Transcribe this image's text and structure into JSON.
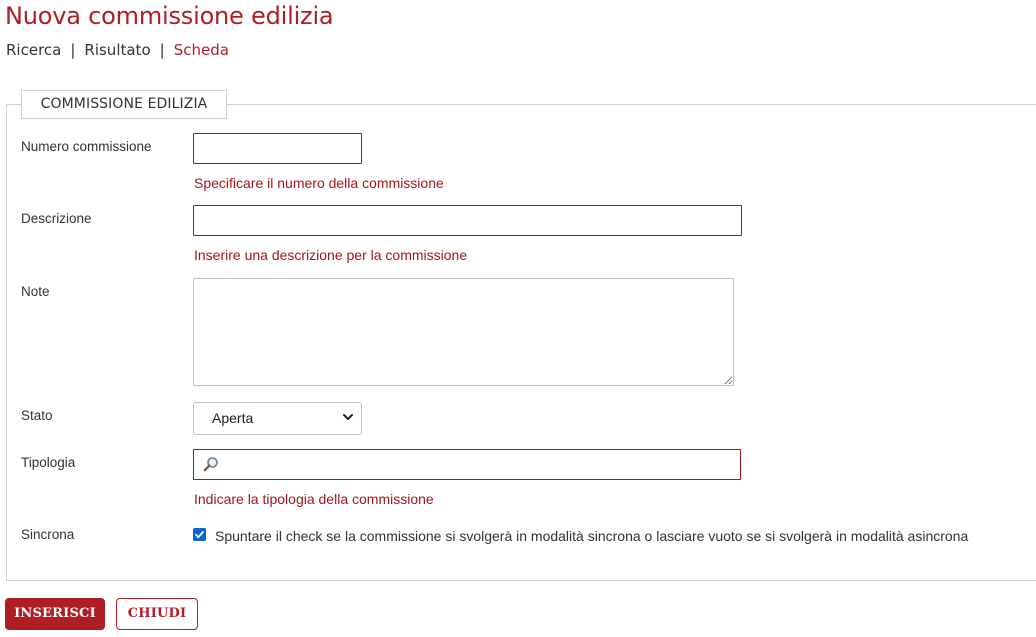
{
  "page": {
    "title": "Nuova commissione edilizia"
  },
  "breadcrumb": {
    "items": [
      {
        "label": "Ricerca"
      },
      {
        "label": "Risultato"
      },
      {
        "label": "Scheda"
      }
    ],
    "separator": "|"
  },
  "form": {
    "legend": "COMMISSIONE EDILIZIA",
    "numero": {
      "label": "Numero commissione",
      "value": "",
      "hint": "Specificare il numero della commissione"
    },
    "descrizione": {
      "label": "Descrizione",
      "value": "",
      "hint": "Inserire una descrizione per la commissione"
    },
    "note": {
      "label": "Note",
      "value": ""
    },
    "stato": {
      "label": "Stato",
      "selected": "Aperta"
    },
    "tipologia": {
      "label": "Tipologia",
      "value": "",
      "icon": "magnifier-icon",
      "hint": "Indicare la tipologia della commissione"
    },
    "sincrona": {
      "label": "Sincrona",
      "checked": true,
      "text": "Spuntare il check se la commissione si svolgerà in modalità sincrona o lasciare vuoto se si svolgerà in modalità asincrona"
    }
  },
  "actions": {
    "insert_label": "INSERISCI",
    "close_label": "CHIUDI"
  },
  "colors": {
    "accent": "#b01e23",
    "checkbox": "#0a66d6"
  }
}
